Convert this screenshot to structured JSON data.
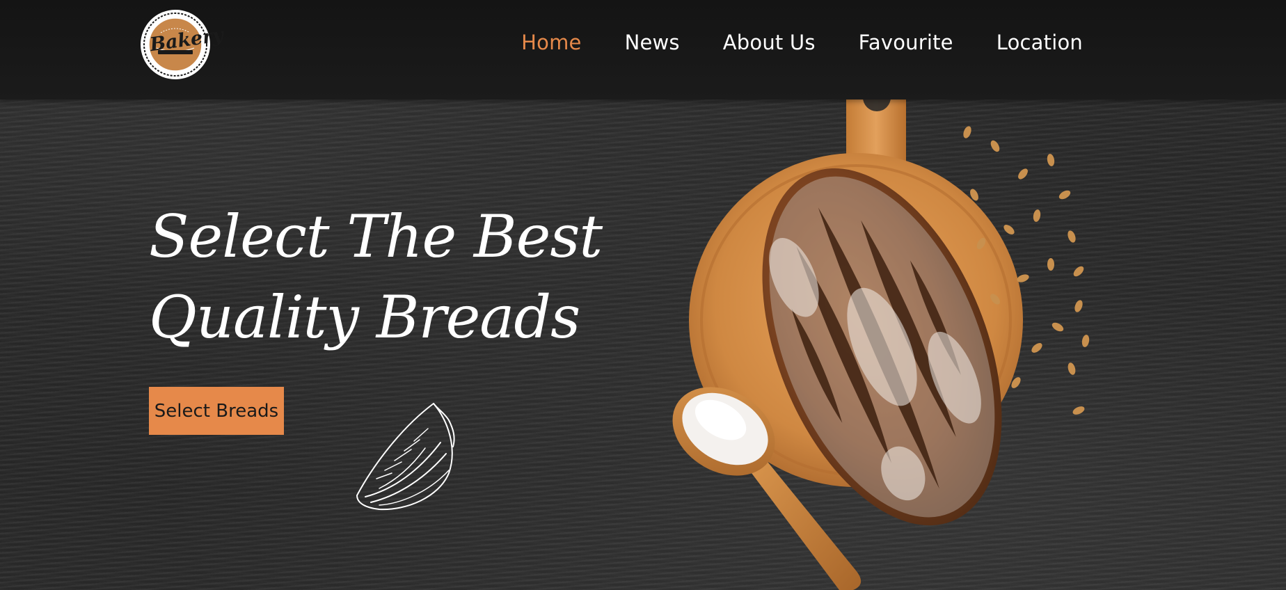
{
  "logo": {
    "brand_text": "Bakery",
    "accent_color": "#c8874a"
  },
  "nav": {
    "items": [
      {
        "label": "Home",
        "active": true
      },
      {
        "label": "News",
        "active": false
      },
      {
        "label": "About Us",
        "active": false
      },
      {
        "label": "Favourite",
        "active": false
      },
      {
        "label": "Location",
        "active": false
      }
    ]
  },
  "hero": {
    "title_line1": "Select The Best",
    "title_line2": "Quality Breads",
    "cta_label": "Select Breads"
  },
  "colors": {
    "accent": "#e6894a",
    "header_bg": "#151515",
    "text": "#ffffff",
    "background": "#2a2a2a"
  },
  "icons": {
    "logo": "bakery-logo-icon",
    "sketch": "dumpling-sketch-icon",
    "hero_image": "bread-on-board-illustration"
  }
}
